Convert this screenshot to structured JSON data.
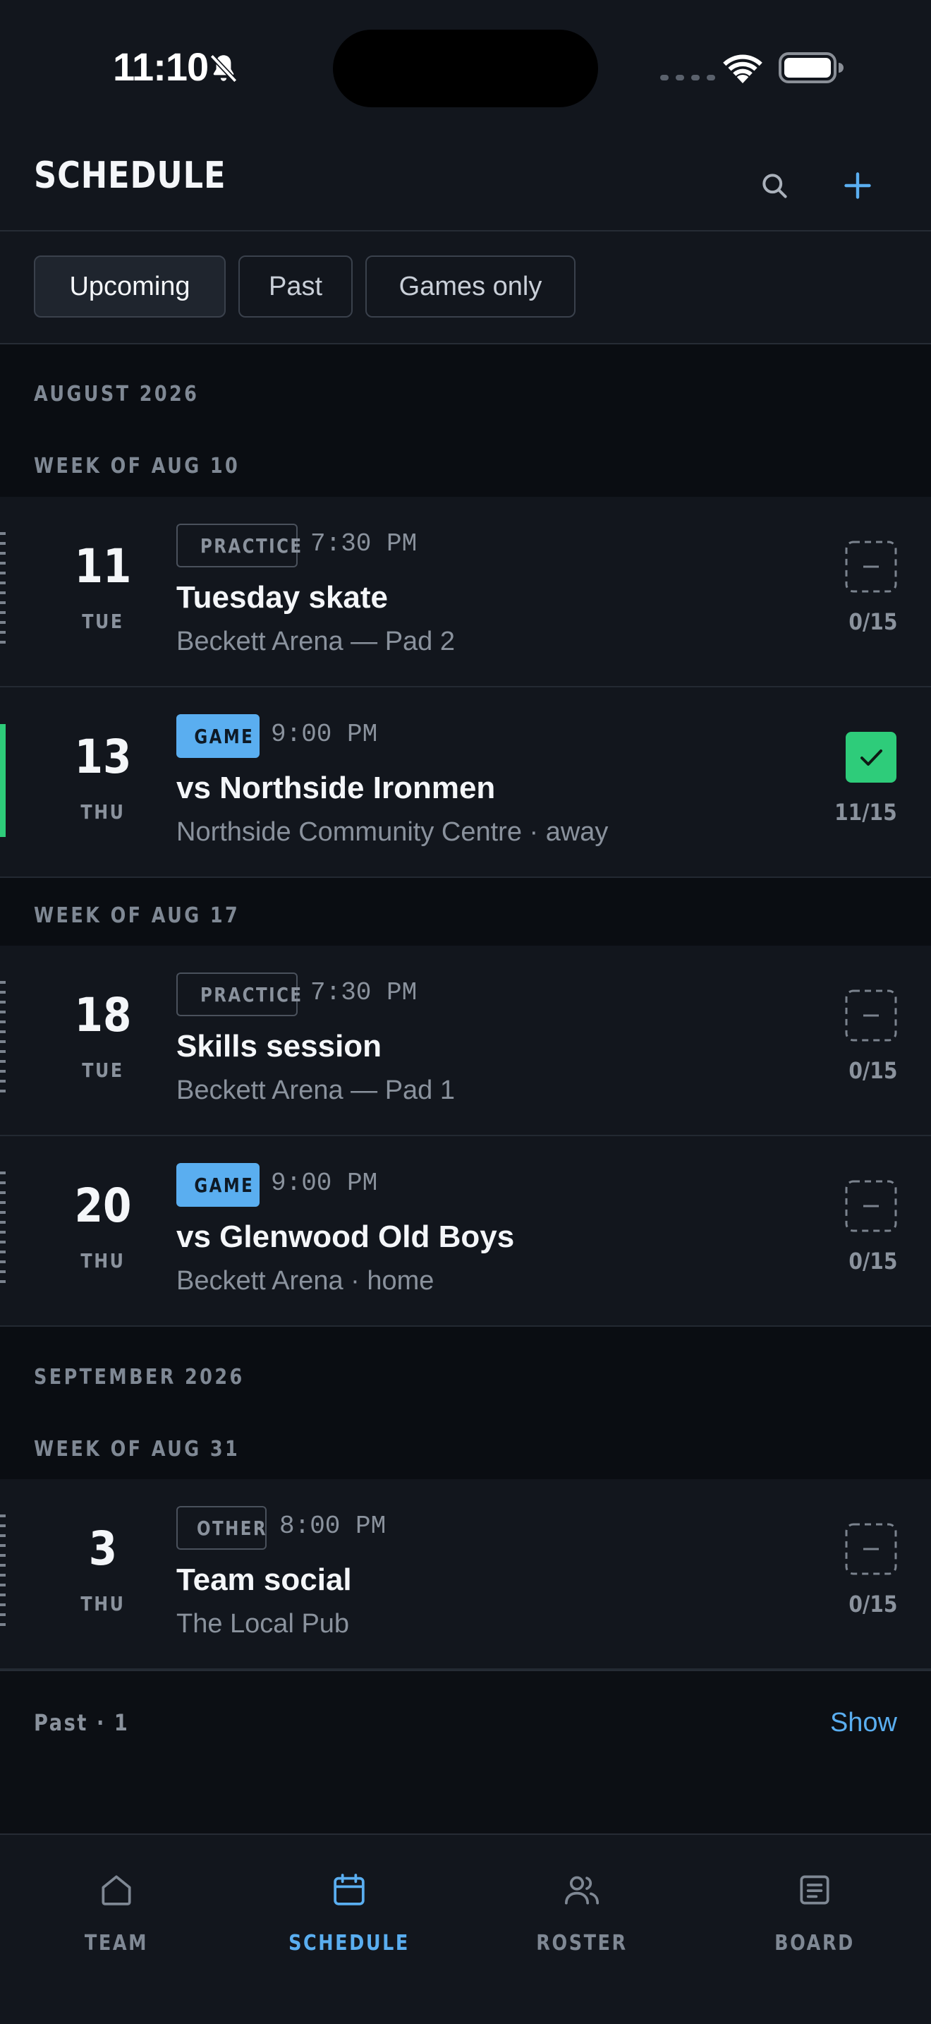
{
  "status_bar": {
    "time": "11:10"
  },
  "header": {
    "title": "SCHEDULE"
  },
  "filters": [
    {
      "label": "Upcoming",
      "active": true
    },
    {
      "label": "Past",
      "active": false
    },
    {
      "label": "Games only",
      "active": false
    }
  ],
  "sections": [
    {
      "month": "AUGUST 2026",
      "weeks": [
        {
          "label": "WEEK OF AUG 10",
          "events": [
            {
              "day": "11",
              "weekday": "TUE",
              "type": "PRACTICE",
              "time": "7:30 PM",
              "title": "Tuesday skate",
              "location": "Beckett Arena — Pad 2",
              "rsvp": "0/15",
              "confirmed": false
            },
            {
              "day": "13",
              "weekday": "THU",
              "type": "GAME",
              "time": "9:00 PM",
              "title": "vs Northside Ironmen",
              "location": "Northside Community Centre · away",
              "rsvp": "11/15",
              "confirmed": true
            }
          ]
        },
        {
          "label": "WEEK OF AUG 17",
          "events": [
            {
              "day": "18",
              "weekday": "TUE",
              "type": "PRACTICE",
              "time": "7:30 PM",
              "title": "Skills session",
              "location": "Beckett Arena — Pad 1",
              "rsvp": "0/15",
              "confirmed": false
            },
            {
              "day": "20",
              "weekday": "THU",
              "type": "GAME",
              "time": "9:00 PM",
              "title": "vs Glenwood Old Boys",
              "location": "Beckett Arena · home",
              "rsvp": "0/15",
              "confirmed": false
            }
          ]
        }
      ]
    },
    {
      "month": "SEPTEMBER 2026",
      "weeks": [
        {
          "label": "WEEK OF AUG 31",
          "events": [
            {
              "day": "3",
              "weekday": "THU",
              "type": "OTHER",
              "time": "8:00 PM",
              "title": "Team social",
              "location": "The Local Pub",
              "rsvp": "0/15",
              "confirmed": false
            }
          ]
        }
      ]
    }
  ],
  "past": {
    "label": "Past · 1",
    "action": "Show"
  },
  "tabs": [
    {
      "label": "TEAM",
      "icon": "home-icon",
      "active": false
    },
    {
      "label": "SCHEDULE",
      "icon": "calendar-icon",
      "active": true
    },
    {
      "label": "ROSTER",
      "icon": "users-icon",
      "active": false
    },
    {
      "label": "BOARD",
      "icon": "document-icon",
      "active": false
    }
  ],
  "colors": {
    "accent": "#5aaef0",
    "confirmed": "#2ecc7a",
    "surface": "#12161d",
    "background": "#0a0d12"
  }
}
